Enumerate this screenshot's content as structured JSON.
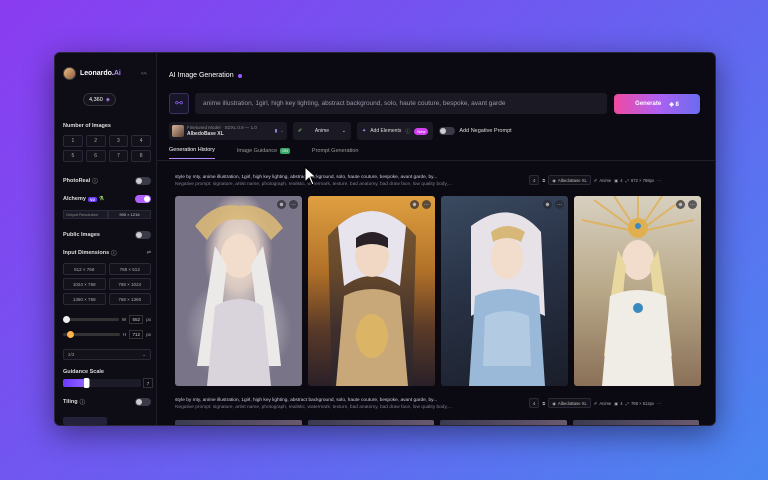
{
  "sidebar": {
    "brand": "Leonardo.",
    "brand_suffix": "Ai",
    "collapse": "<<",
    "tokens": "4,360",
    "number_of_images_label": "Number of Images",
    "image_counts": [
      "1",
      "2",
      "3",
      "4",
      "5",
      "6",
      "7",
      "8"
    ],
    "photoreal_label": "PhotoReal",
    "alchemy_label": "Alchemy",
    "alchemy_badge": "V2",
    "alchemy_fields": [
      "Output Resolution",
      "900 × 1216"
    ],
    "public_images_label": "Public Images",
    "input_dimensions_label": "Input Dimensions",
    "dimensions": [
      "512 × 768",
      "768 × 512",
      "1024 × 768",
      "768 × 1024",
      "1360 × 768",
      "768 × 1360"
    ],
    "width_label": "W",
    "width_value": "552",
    "width_unit": "px",
    "height_label": "H",
    "height_value": "712",
    "height_unit": "px",
    "aspect_value": "2/3",
    "guidance_scale_label": "Guidance Scale",
    "guidance_value": "7",
    "tiling_label": "Tiling",
    "toggles": {
      "photoreal": false,
      "alchemy": true,
      "public_images": false,
      "tiling": false
    }
  },
  "main": {
    "title": "AI Image Generation",
    "prompt": "anime illustration, 1girl, high key lighting, abstract background, solo, haute couture, bespoke, avant garde",
    "generate_label": "Generate",
    "generate_cost": "8",
    "model_caption": "Finetuned Model",
    "model_extra": "SDXL 0.9 — 1.0",
    "model_name": "AlbedoBase XL",
    "style_label": "Anime",
    "elements_label": "Add Elements",
    "elements_badge": "New",
    "negative_label": "Add Negative Prompt",
    "tabs": [
      "Generation History",
      "Image Guidance",
      "Prompt Generation"
    ],
    "image_guidance_badge": "ON"
  },
  "generations": [
    {
      "prompt": "style by mty, anime illustration, 1girl, high key lighting, abstract background, solo, haute couture, bespoke, avant garde, by...",
      "negative": "Negative prompt: signature, artist name, photograph, realistic, watermark, texture, bad anatomy, bad draw face, low quality body,...",
      "count": "4",
      "model": "AlbedoBase XL",
      "style": "Anime",
      "quantity": "4",
      "size": "672 × 768px"
    },
    {
      "prompt": "style by mty, anime illustration, 1girl, high key lighting, abstract background, solo, haute couture, bespoke, avant garde, by...",
      "negative": "Negative prompt: signature, artist name, photograph, realistic, watermark, texture, bad anatomy, bad draw face, low quality body,...",
      "count": "4",
      "model": "AlbedoBase XL",
      "style": "Anime",
      "quantity": "4",
      "size": "768 × 512px"
    }
  ],
  "colors": {
    "accent": "#b060ff",
    "generate_gradient": [
      "#f04aa0",
      "#b060f0",
      "#6a6cf0"
    ],
    "background_gradient": [
      "#8a3cf0",
      "#4a86f0"
    ]
  }
}
